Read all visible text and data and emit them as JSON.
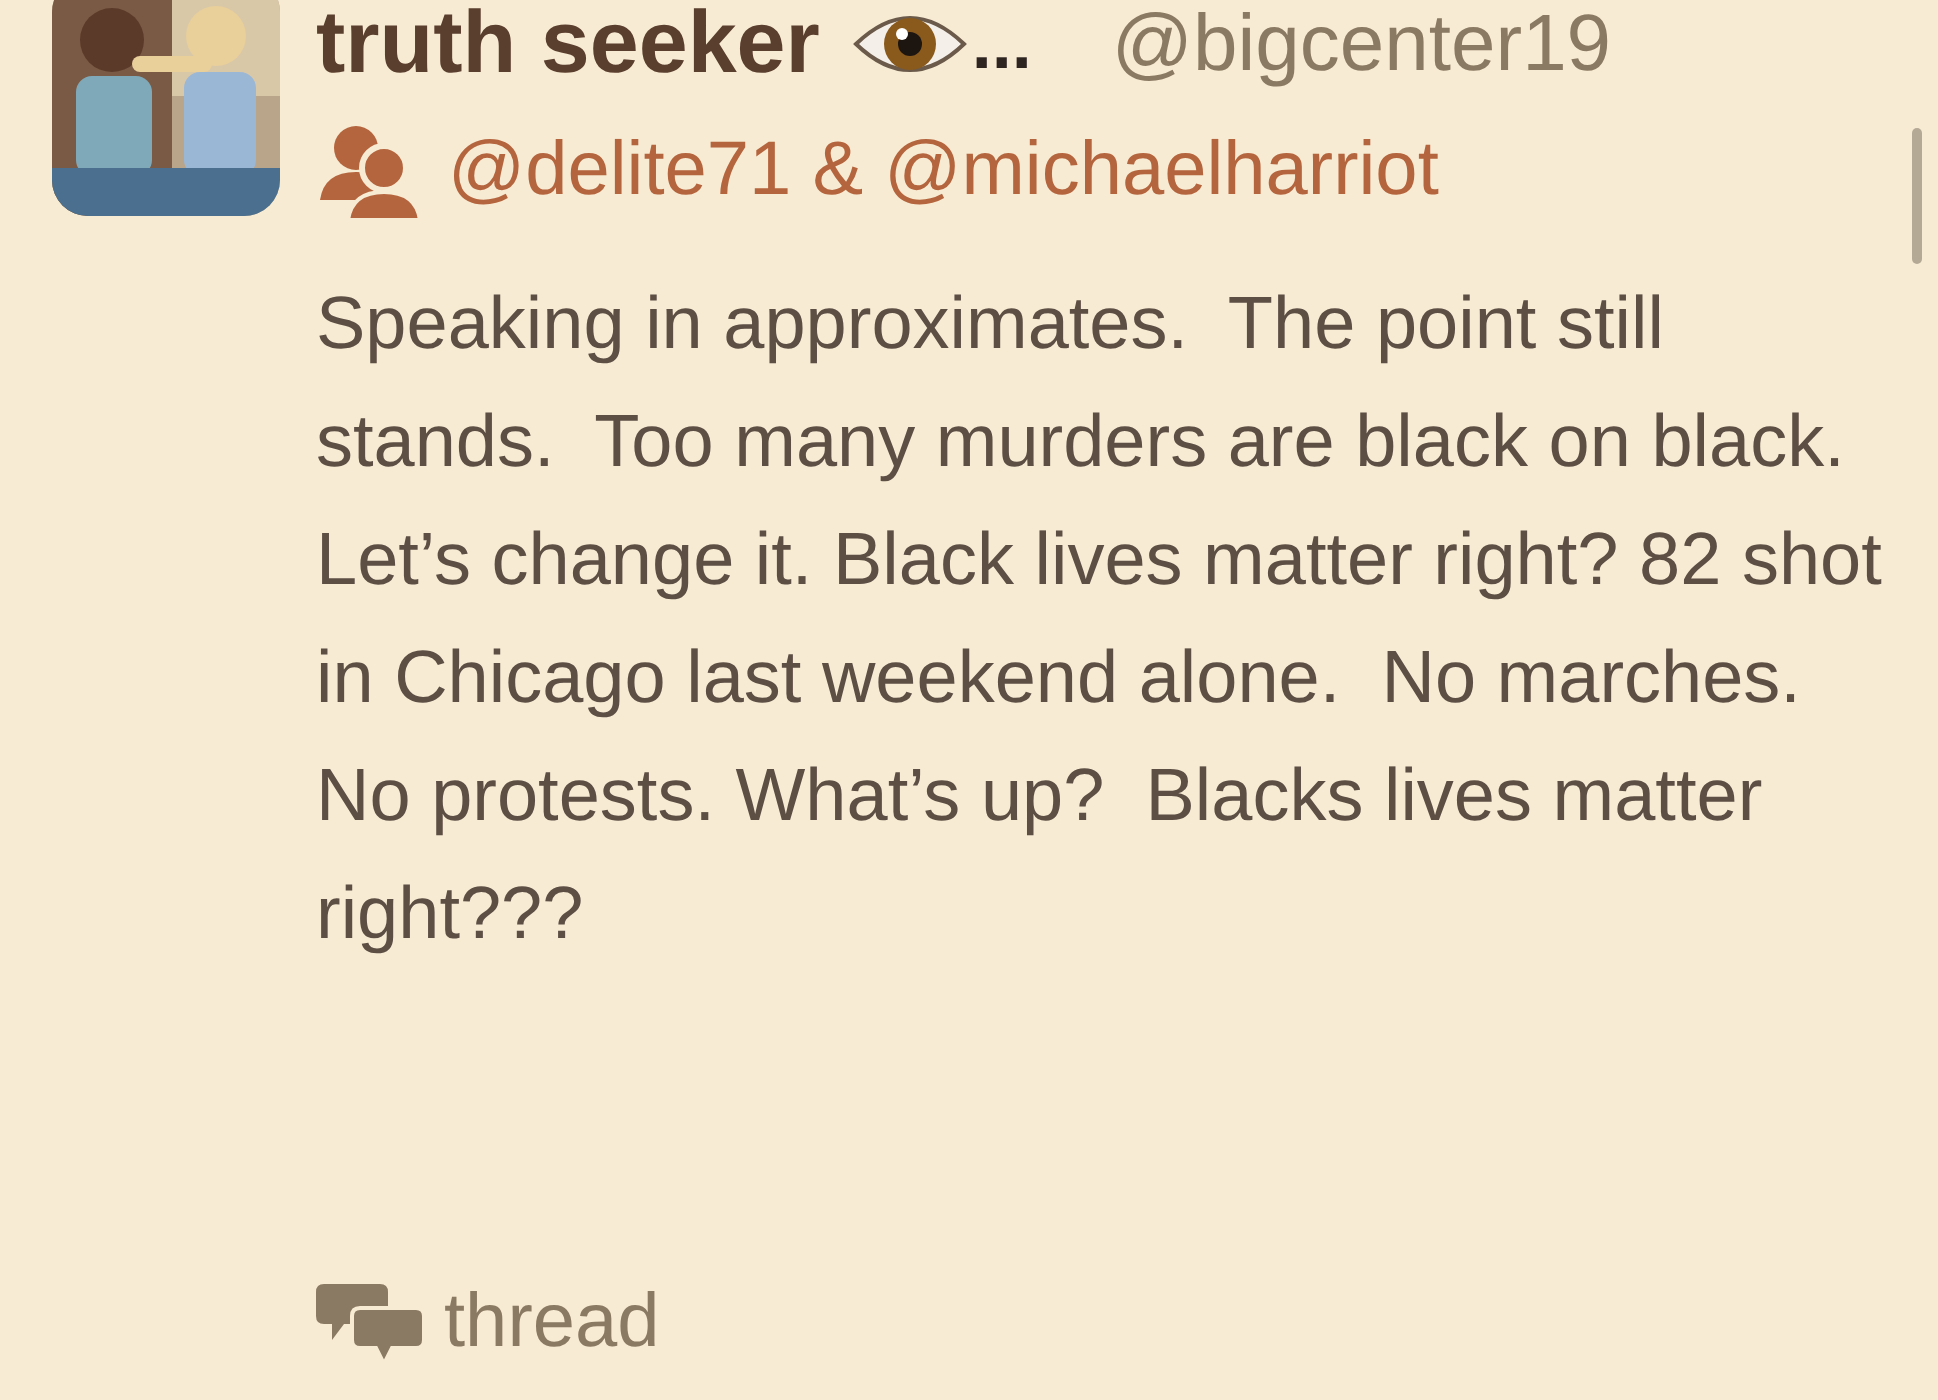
{
  "post": {
    "author": {
      "display_name": "truth seeker",
      "name_truncation": "...",
      "handle": "@bigcenter19"
    },
    "recipients": "@delite71 & @michaelharriot",
    "body": "Speaking in approximates.  The point still stands.  Too many murders are black on black.  Let’s change it. Black lives matter right? 82 shot in Chicago last weekend alone.  No marches.  No protests. What’s up?  Blacks lives matter right???",
    "thread_link": "thread"
  }
}
